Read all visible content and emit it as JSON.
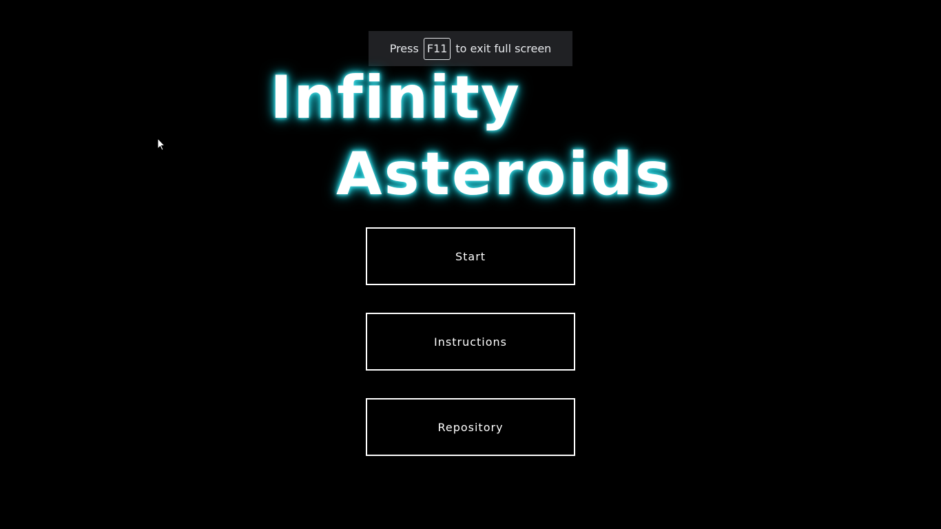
{
  "fullscreen_notice": {
    "before": "Press",
    "key": "F11",
    "after": "to exit full screen"
  },
  "title": {
    "line1": "Infinity",
    "line2": "Asteroids",
    "glow_color": "#19b8c4"
  },
  "menu": {
    "start_label": "Start",
    "instructions_label": "Instructions",
    "repository_label": "Repository"
  },
  "icons": {
    "cursor": "mouse-pointer-icon"
  }
}
